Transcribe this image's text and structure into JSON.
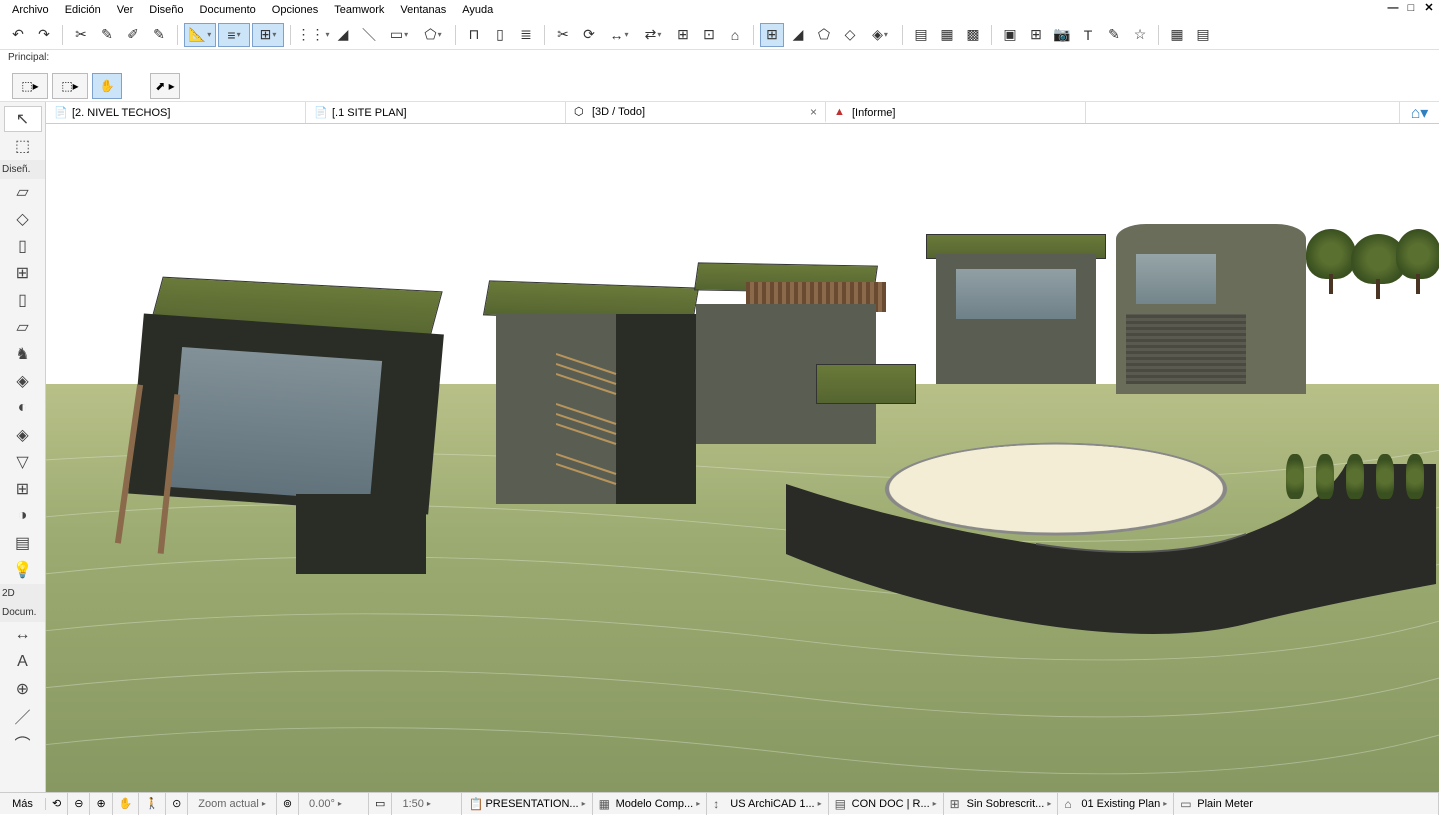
{
  "menu": {
    "items": [
      "Archivo",
      "Edición",
      "Ver",
      "Diseño",
      "Documento",
      "Opciones",
      "Teamwork",
      "Ventanas",
      "Ayuda"
    ]
  },
  "principal_label": "Principal:",
  "left_toolbox": {
    "section_design": "Diseñ.",
    "section_2d": "2D",
    "section_doc": "Docum.",
    "section_more": "Más"
  },
  "tabs": [
    {
      "label": "[2. NIVEL TECHOS]",
      "active": false
    },
    {
      "label": "[.1 SITE PLAN]",
      "active": false
    },
    {
      "label": "[3D / Todo]",
      "active": true
    },
    {
      "label": "[Informe]",
      "active": false
    }
  ],
  "statusbar": {
    "more": "Más",
    "zoom_label": "Zoom actual",
    "angle": "0.00°",
    "scale": "1:50",
    "items": [
      "PRESENTATION...",
      "Modelo Comp...",
      "US ArchiCAD 1...",
      "CON DOC | R...",
      "Sin Sobrescrit...",
      "01 Existing Plan",
      "Plain Meter"
    ]
  }
}
